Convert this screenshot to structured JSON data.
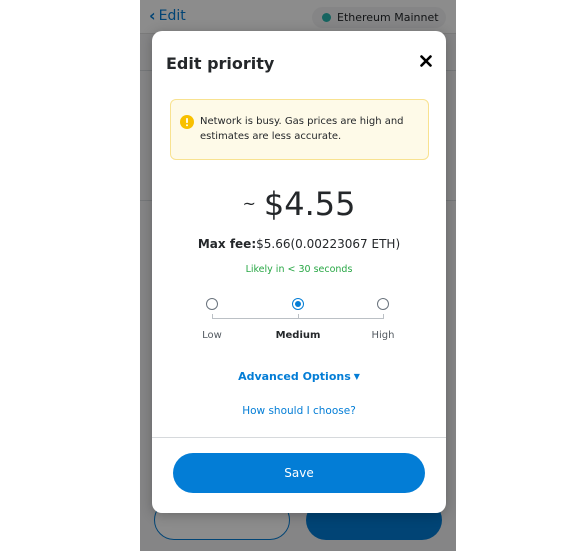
{
  "header": {
    "back_label": "Edit",
    "network_label": "Ethereum Mainnet"
  },
  "modal": {
    "title": "Edit priority",
    "warning_text": "Network is busy. Gas prices are high and estimates are less accurate.",
    "fee_prefix": "~",
    "fee_amount": "$4.55",
    "max_fee_label": "Max fee:",
    "max_fee_value": "$5.66",
    "max_fee_eth": "(0.00223067 ETH)",
    "likely_text": "Likely in < 30 seconds",
    "options": [
      {
        "label": "Low",
        "selected": false
      },
      {
        "label": "Medium",
        "selected": true
      },
      {
        "label": "High",
        "selected": false
      }
    ],
    "advanced_options_label": "Advanced Options",
    "how_to_choose_label": "How should I choose?",
    "save_label": "Save"
  },
  "colors": {
    "primary_blue": "#037dd6",
    "success_green": "#28a745",
    "warning_bg": "#fefae8",
    "warning_border": "#f8e290",
    "warning_icon": "#f8c000",
    "network_dot": "#29b6af"
  },
  "icons": [
    "chevron-left-icon",
    "network-dot-icon",
    "close-icon",
    "warning-icon",
    "caret-down-icon"
  ]
}
